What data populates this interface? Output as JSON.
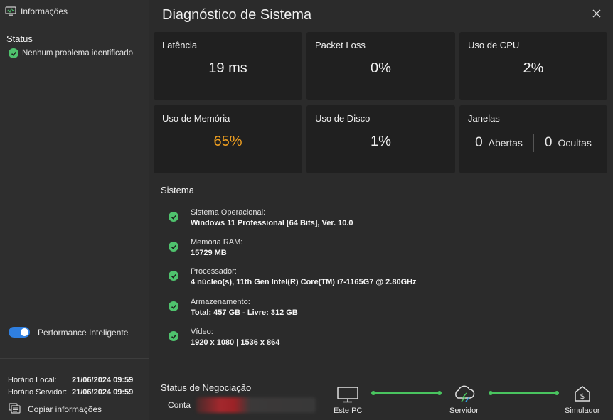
{
  "sidebar": {
    "header": "Informações",
    "status_title": "Status",
    "status_text": "Nenhum problema identificado",
    "toggle_label": "Performance Inteligente",
    "toggle_on": true,
    "local_time_label": "Horário Local:",
    "local_time_value": "21/06/2024 09:59",
    "server_time_label": "Horário Servidor:",
    "server_time_value": "21/06/2024 09:59",
    "copy_label": "Copiar informações"
  },
  "main": {
    "title": "Diagnóstico de Sistema",
    "cards": [
      {
        "label": "Latência",
        "value": "19 ms"
      },
      {
        "label": "Packet Loss",
        "value": "0%"
      },
      {
        "label": "Uso de CPU",
        "value": "2%"
      },
      {
        "label": "Uso de Memória",
        "value": "65%"
      },
      {
        "label": "Uso de Disco",
        "value": "1%"
      }
    ],
    "windows": {
      "label": "Janelas",
      "open_count": "0",
      "open_label": "Abertas",
      "hidden_count": "0",
      "hidden_label": "Ocultas"
    },
    "system_title": "Sistema",
    "system": [
      {
        "key": "Sistema Operacional:",
        "value": "Windows 11 Professional [64 Bits], Ver. 10.0"
      },
      {
        "key": "Memória RAM:",
        "value": "15729 MB"
      },
      {
        "key": "Processador:",
        "value": "4 núcleo(s), 11th Gen Intel(R) Core(TM) i7-1165G7 @ 2.80GHz"
      },
      {
        "key": "Armazenamento:",
        "value": "Total: 457 GB - Livre: 312 GB"
      },
      {
        "key": "Vídeo:",
        "value": "1920 x 1080 | 1536 x 864"
      }
    ],
    "negotiation_title": "Status de Negociação",
    "account_label": "Conta",
    "nodes": {
      "pc": "Este PC",
      "server": "Servidor",
      "simulator": "Simulador"
    }
  },
  "colors": {
    "accent_ok": "#4fc26d",
    "warn": "#f0a020",
    "toggle": "#2f7fe0"
  }
}
